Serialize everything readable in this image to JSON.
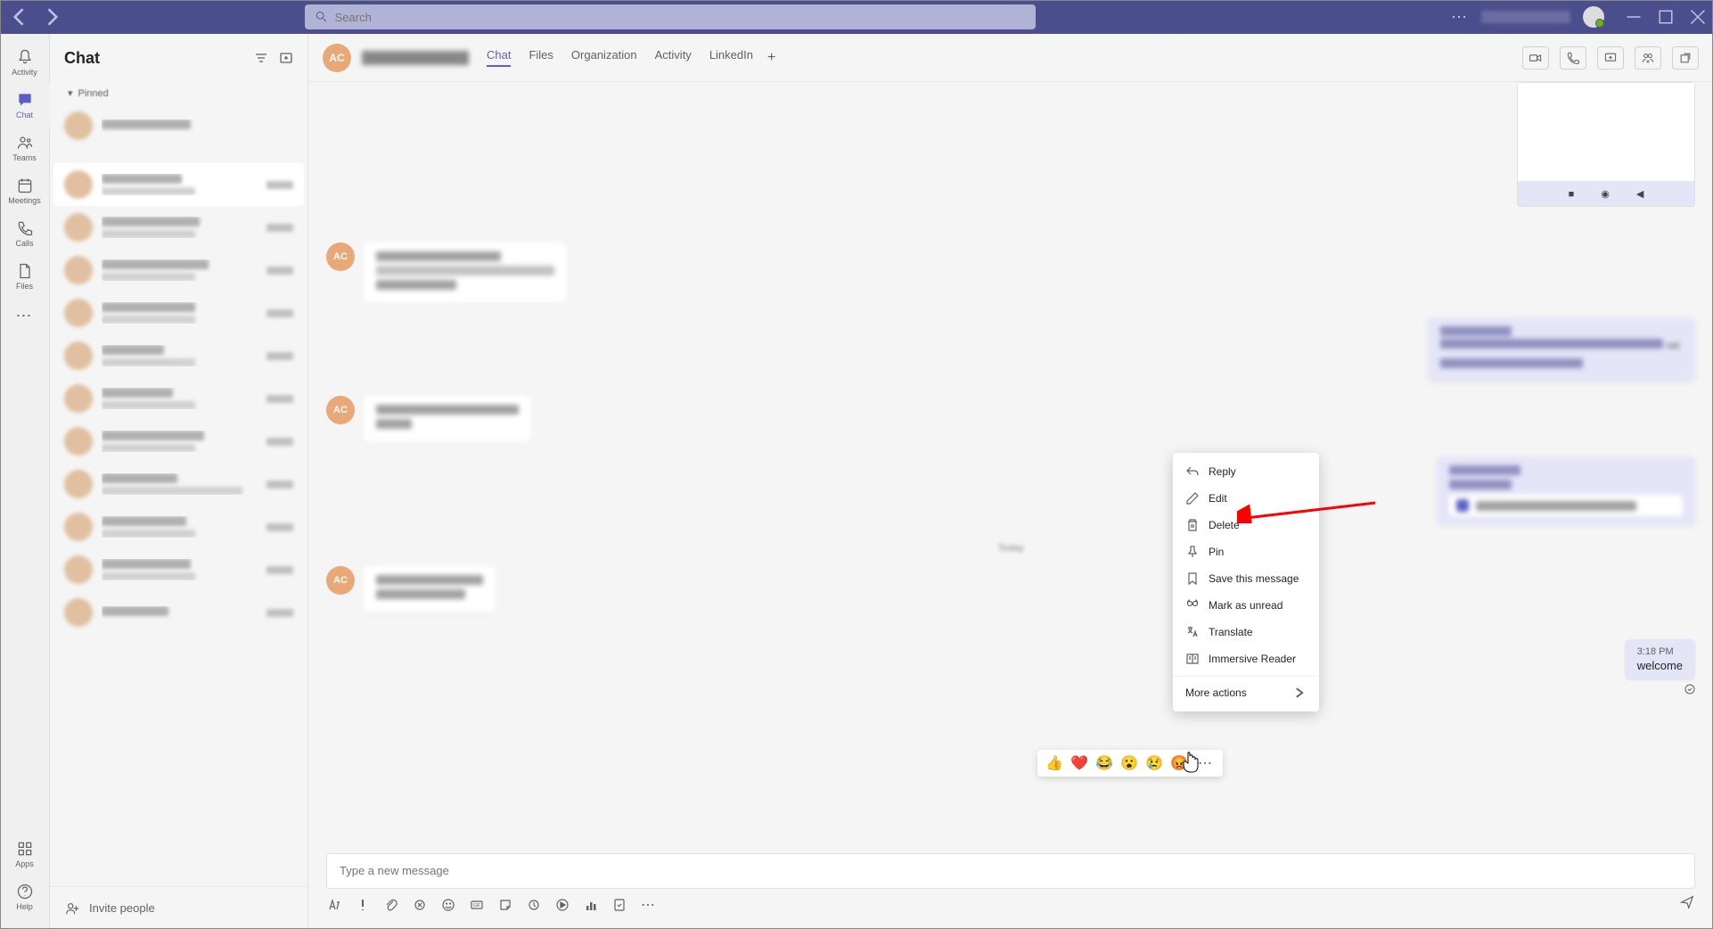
{
  "titlebar": {
    "search_placeholder": "Search"
  },
  "rail": {
    "items": [
      {
        "label": "Activity"
      },
      {
        "label": "Chat"
      },
      {
        "label": "Teams"
      },
      {
        "label": "Meetings"
      },
      {
        "label": "Calls"
      },
      {
        "label": "Files"
      }
    ],
    "bottom": [
      {
        "label": "Apps"
      },
      {
        "label": "Help"
      }
    ]
  },
  "chat_panel": {
    "title": "Chat",
    "section_pinned": "Pinned",
    "invite_label": "Invite people"
  },
  "topbar": {
    "initials": "AC",
    "tabs": [
      {
        "label": "Chat"
      },
      {
        "label": "Files"
      },
      {
        "label": "Organization"
      },
      {
        "label": "Activity"
      },
      {
        "label": "LinkedIn"
      }
    ]
  },
  "messages": {
    "avatar_initials": "AC",
    "target": {
      "time": "3:18 PM",
      "text": "welcome"
    },
    "shared_blur_text": "nei"
  },
  "context_menu": {
    "reply": "Reply",
    "edit": "Edit",
    "delete": "Delete",
    "pin": "Pin",
    "save": "Save this message",
    "mark_unread": "Mark as unread",
    "translate": "Translate",
    "immersive": "Immersive Reader",
    "more": "More actions"
  },
  "compose": {
    "placeholder": "Type a new message"
  },
  "colors": {
    "titlebar": "#4a4e8c",
    "accent": "#5b5fc7",
    "sent_bubble": "#e5e5f8"
  }
}
